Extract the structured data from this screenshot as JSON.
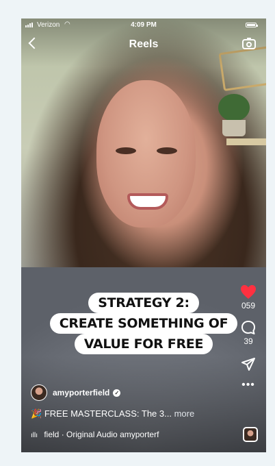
{
  "status_bar": {
    "carrier": "Verizon",
    "time": "4:09 PM"
  },
  "header": {
    "title": "Reels"
  },
  "overlay": {
    "lines": [
      "STRATEGY 2:",
      "CREATE SOMETHING OF",
      "VALUE FOR FREE"
    ]
  },
  "actions": {
    "likes": "059",
    "comments": "39",
    "more": "•••"
  },
  "post": {
    "username": "amyporterfield",
    "caption_emoji": "🎉",
    "caption": "FREE MASTERCLASS: The 3...",
    "more_label": "more",
    "audio": "field · Original Audio  amyporterf"
  },
  "colors": {
    "like_red": "#ff3040",
    "page_bg": "#eef4f7"
  }
}
